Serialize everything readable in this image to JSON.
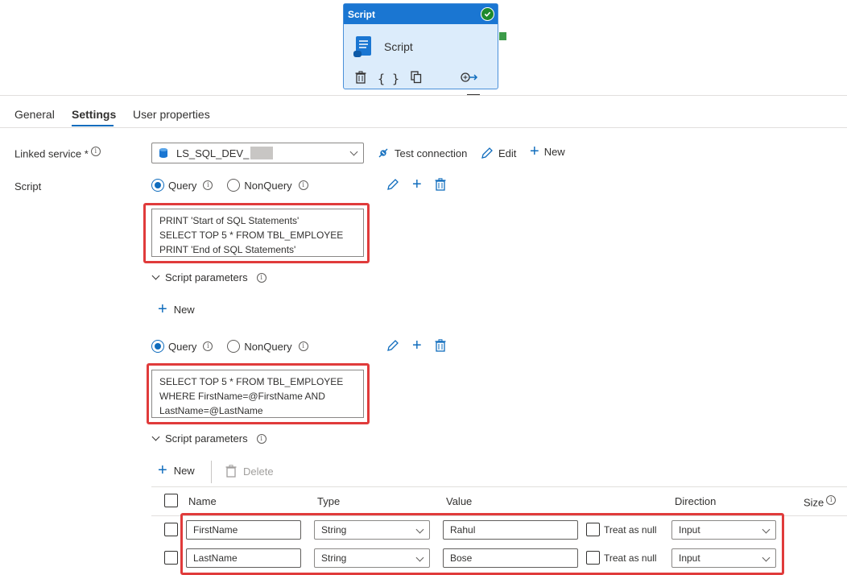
{
  "activity": {
    "header": "Script",
    "name": "Script",
    "status_icon": "success-check-icon",
    "tools": [
      "delete-icon",
      "code-braces-icon",
      "copy-icon",
      "connect-icon"
    ]
  },
  "tabs": [
    "General",
    "Settings",
    "User properties"
  ],
  "active_tab": "Settings",
  "linked_service": {
    "label": "Linked service *",
    "value": "LS_SQL_DEV_",
    "test_connection": "Test connection",
    "edit": "Edit",
    "new": "New"
  },
  "script_label": "Script",
  "scripts": [
    {
      "type_options": [
        "Query",
        "NonQuery"
      ],
      "selected": "Query",
      "text": "PRINT 'Start of SQL Statements'\nSELECT TOP 5 * FROM TBL_EMPLOYEE\nPRINT 'End of SQL Statements'",
      "params_label": "Script parameters",
      "new_label": "New"
    },
    {
      "type_options": [
        "Query",
        "NonQuery"
      ],
      "selected": "Query",
      "text": "SELECT TOP 5 * FROM TBL_EMPLOYEE\nWHERE FirstName=@FirstName AND\nLastName=@LastName",
      "params_label": "Script parameters",
      "new_label": "New",
      "delete_label": "Delete"
    }
  ],
  "param_table": {
    "headers": [
      "Name",
      "Type",
      "Value",
      "Direction",
      "Size"
    ],
    "treat_as_null": "Treat as null",
    "rows": [
      {
        "name": "FirstName",
        "type": "String",
        "value": "Rahul",
        "direction": "Input"
      },
      {
        "name": "LastName",
        "type": "String",
        "value": "Bose",
        "direction": "Input"
      }
    ]
  },
  "colors": {
    "accent": "#0f6cbd",
    "highlight": "#e03b3b",
    "card_header": "#1a76d2",
    "card_body": "#dcecfb"
  }
}
